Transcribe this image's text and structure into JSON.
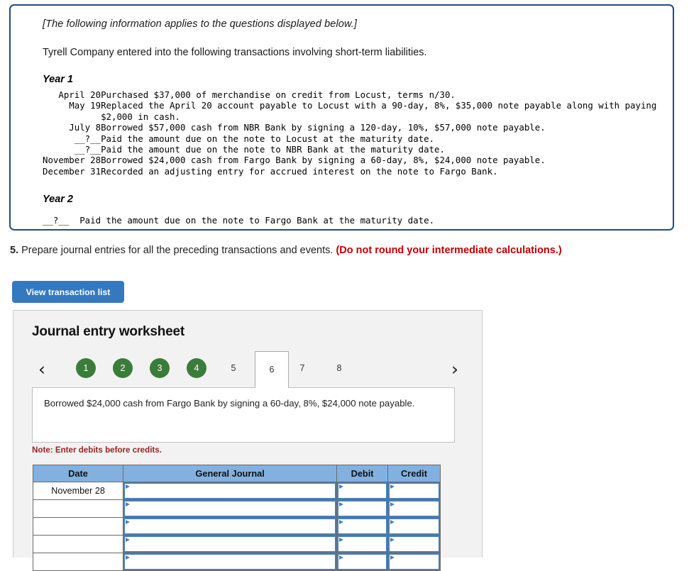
{
  "info_box": {
    "applies_note": "[The following information applies to the questions displayed below.]",
    "intro": "Tyrell Company entered into the following transactions involving short-term liabilities.",
    "year1_heading": "Year 1",
    "year2_heading": "Year 2",
    "year1_transactions": [
      {
        "date": "April 20",
        "description": "Purchased $37,000 of merchandise on credit from Locust, terms n/30."
      },
      {
        "date": "May 19",
        "description": "Replaced the April 20 account payable to Locust with a 90-day, 8%, $35,000 note payable along with paying"
      },
      {
        "date": "",
        "description": "$2,000 in cash."
      },
      {
        "date": "July 8",
        "description": "Borrowed $57,000 cash from NBR Bank by signing a 120-day, 10%, $57,000 note payable."
      },
      {
        "date": "__?__",
        "description": "Paid the amount due on the note to Locust at the maturity date."
      },
      {
        "date": "__?__",
        "description": "Paid the amount due on the note to NBR Bank at the maturity date."
      },
      {
        "date": "November 28",
        "description": "Borrowed $24,000 cash from Fargo Bank by signing a 60-day, 8%, $24,000 note payable."
      },
      {
        "date": "December 31",
        "description": "Recorded an adjusting entry for accrued interest on the note to Fargo Bank."
      }
    ],
    "year2_line": "__?__  Paid the amount due on the note to Fargo Bank at the maturity date."
  },
  "question": {
    "number": "5.",
    "text": "Prepare journal entries for all the preceding transactions and events.",
    "warning": "(Do not round your intermediate calculations.)"
  },
  "buttons": {
    "view_transaction_list": "View transaction list"
  },
  "worksheet": {
    "title": "Journal entry worksheet",
    "prev_arrow": "‹",
    "next_arrow": "›",
    "tabs": [
      {
        "label": "1",
        "state": "done"
      },
      {
        "label": "2",
        "state": "done"
      },
      {
        "label": "3",
        "state": "done"
      },
      {
        "label": "4",
        "state": "done"
      },
      {
        "label": "5",
        "state": "plain"
      },
      {
        "label": "6",
        "state": "active"
      },
      {
        "label": "7",
        "state": "plain"
      },
      {
        "label": "8",
        "state": "plain"
      }
    ],
    "description": "Borrowed $24,000 cash from Fargo Bank by signing a 60-day, 8%, $24,000 note payable.",
    "note": "Note: Enter debits before credits.",
    "table": {
      "headers": [
        "Date",
        "General Journal",
        "Debit",
        "Credit"
      ],
      "rows": [
        {
          "date": "November 28",
          "general_journal": "",
          "debit": "",
          "credit": ""
        },
        {
          "date": "",
          "general_journal": "",
          "debit": "",
          "credit": ""
        },
        {
          "date": "",
          "general_journal": "",
          "debit": "",
          "credit": ""
        },
        {
          "date": "",
          "general_journal": "",
          "debit": "",
          "credit": ""
        },
        {
          "date": "",
          "general_journal": "",
          "debit": "",
          "credit": ""
        }
      ]
    }
  },
  "colors": {
    "info_border": "#1f4e79",
    "button_blue": "#3479bf",
    "tab_done_green": "#3a7d3a",
    "warning_red": "#c00000",
    "note_red": "#9b2222",
    "table_header_blue": "#82b1e0",
    "panel_gray": "#f2f2f2"
  }
}
